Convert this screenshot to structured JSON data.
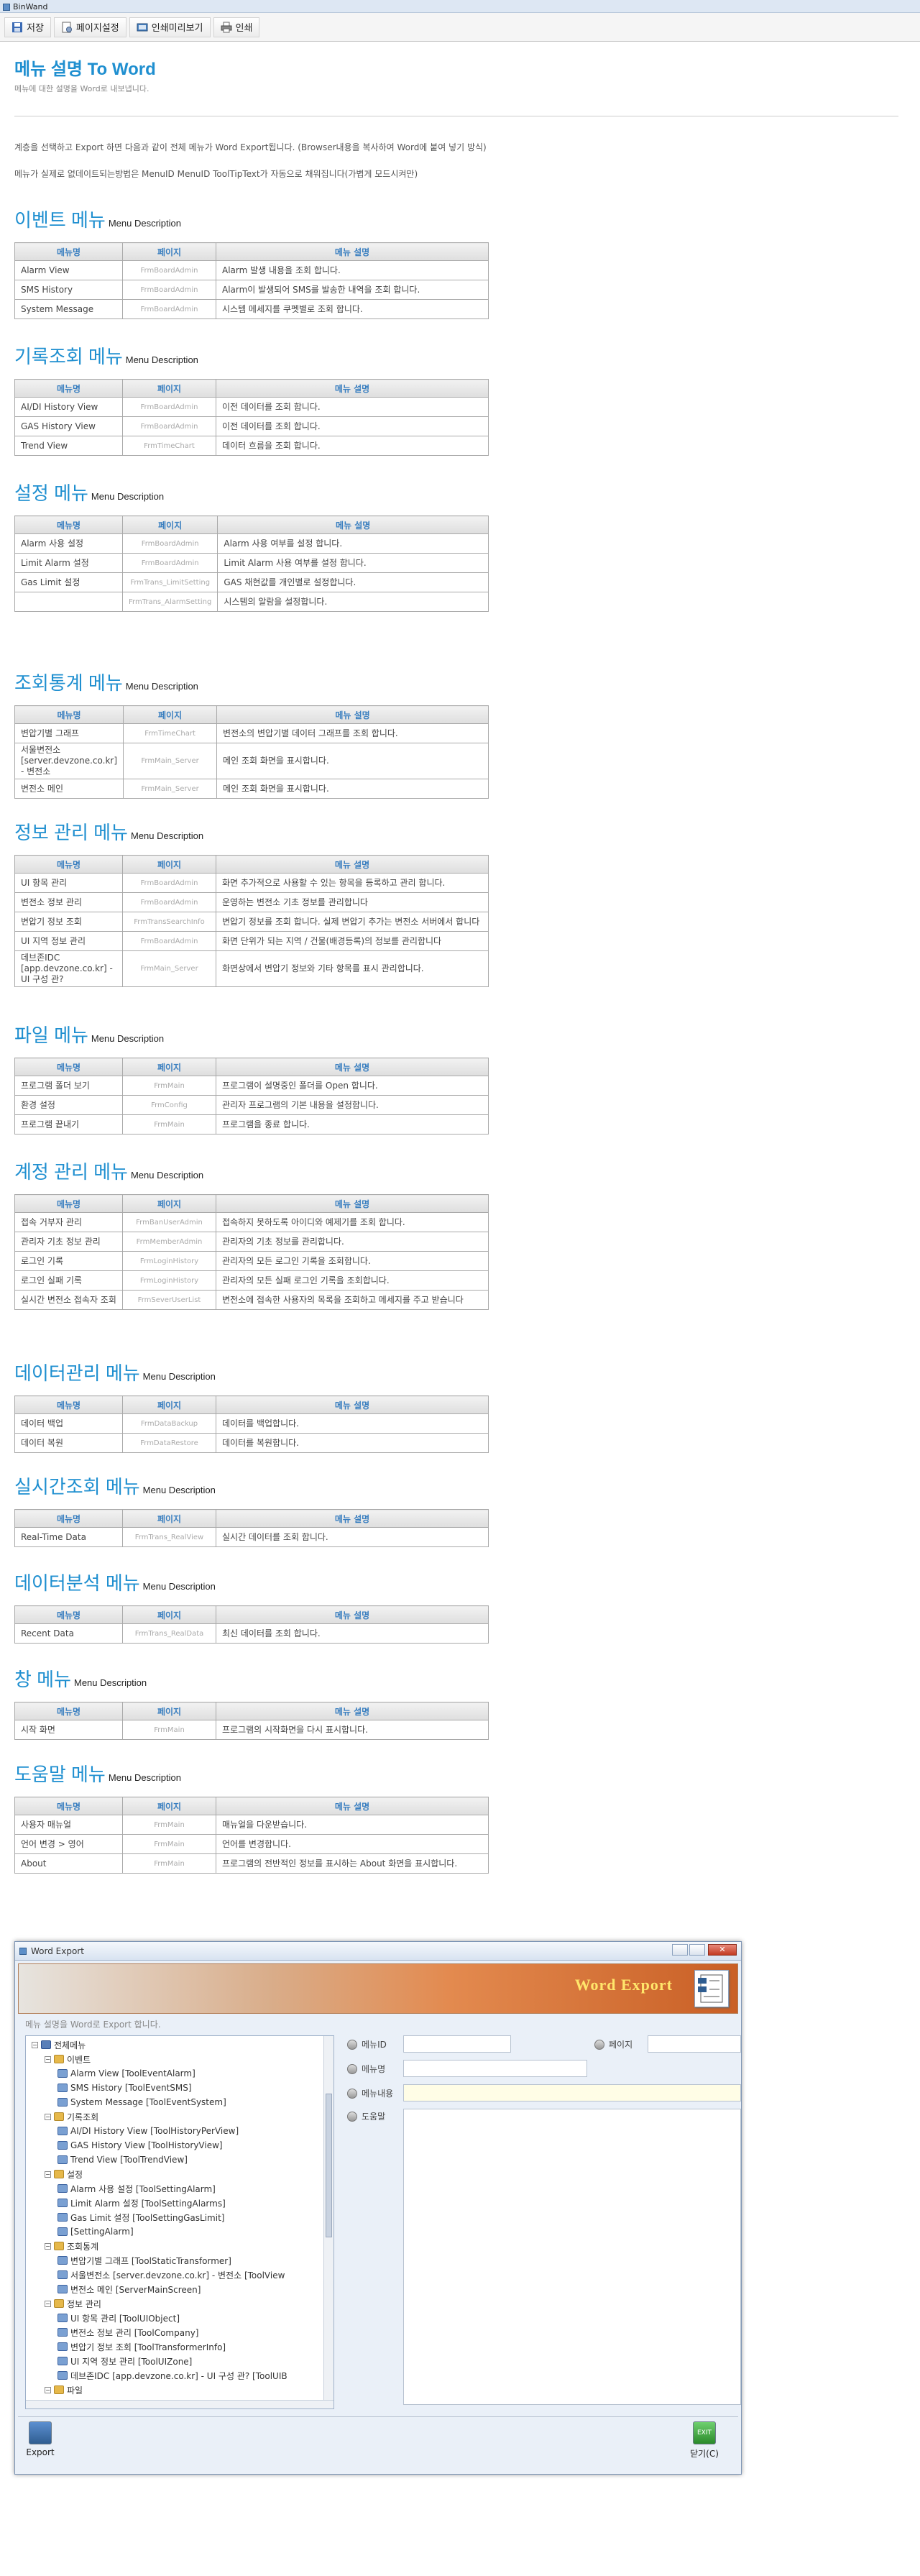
{
  "window_title": "BinWand",
  "toolbar": {
    "save": "저장",
    "page_setup": "페이지설정",
    "print_preview": "인쇄미리보기",
    "print": "인쇄"
  },
  "doc": {
    "title": "메뉴 설명 To Word",
    "subtitle": "메뉴에 대한 설명을 Word로 내보냅니다.",
    "note1": "계층을 선택하고 Export 하면 다음과 같이 전체 메뉴가 Word Export됩니다. (Browser내용을 복사하여 Word에 붙여 넣기 방식)",
    "note2": "메뉴가 실제로 없데이트되는방법은 MenuID MenuID ToolTipText가 자동으로 채워집니다(가볍게 모드시켜만)"
  },
  "table_headers": [
    "메뉴명",
    "페이지",
    "메뉴 설명"
  ],
  "desc_label": "Menu Description",
  "sections": [
    {
      "title": "이벤트 메뉴",
      "rows": [
        [
          "Alarm View",
          "FrmBoardAdmin",
          "Alarm 발생 내용을 조회 합니다."
        ],
        [
          "SMS History",
          "FrmBoardAdmin",
          "Alarm이 발생되어 SMS를 발송한 내역을 조회 합니다."
        ],
        [
          "System Message",
          "FrmBoardAdmin",
          "시스템 메세지를 쿠펫별로 조회 합니다."
        ]
      ]
    },
    {
      "title": "기록조회 메뉴",
      "rows": [
        [
          "AI/DI History View",
          "FrmBoardAdmin",
          "이전 데이터를 조회 합니다."
        ],
        [
          "GAS History View",
          "FrmBoardAdmin",
          "이전 데이터를 조회 합니다."
        ],
        [
          "Trend View",
          "FrmTimeChart",
          "데이터 흐름을 조회 합니다."
        ]
      ]
    },
    {
      "title": "설정 메뉴",
      "rows": [
        [
          "Alarm 사용 설정",
          "FrmBoardAdmin",
          "Alarm 사용 여부를 설정 합니다."
        ],
        [
          "Limit Alarm 설정",
          "FrmBoardAdmin",
          "Limit Alarm 사용 여부를 설정 합니다."
        ],
        [
          "Gas Limit 설정",
          "FrmTrans_LimitSetting",
          "GAS 채현값를 개인별로 설정합니다."
        ],
        [
          "",
          "FrmTrans_AlarmSetting",
          "시스템의 알람을 설정합니다."
        ]
      ]
    },
    {
      "title": "조회통계 메뉴",
      "rows": [
        [
          "변압기별 그래프",
          "FrmTimeChart",
          "변전소의 변압기별 데이터 그래프를 조회 합니다."
        ],
        [
          "서울변전소 [server.devzone.co.kr] - 변전소",
          "FrmMain_Server",
          "메인 조회 화면을 표시합니다."
        ],
        [
          "변전소 메인",
          "FrmMain_Server",
          "메인 조회 화면을 표시합니다."
        ]
      ]
    },
    {
      "title": "정보 관리 메뉴",
      "rows": [
        [
          "UI 항목 관리",
          "FrmBoardAdmin",
          "화면 추가적으로 사용할 수 있는 항목을 등록하고 관리 합니다."
        ],
        [
          "변전소 정보 관리",
          "FrmBoardAdmin",
          "운영하는 변전소 기초 정보를 관리합니다"
        ],
        [
          "변압기 정보 조회",
          "FrmTransSearchInfo",
          "변압기 정보를 조회 합니다. 실제 변압기 추가는 변전소 서버에서 합니다"
        ],
        [
          "UI 지역 정보 관리",
          "FrmBoardAdmin",
          "화면 단위가 되는 지역 / 건물(배경등록)의 정보를 관리합니다"
        ],
        [
          "데브존IDC [app.devzone.co.kr] - UI 구성 관?",
          "FrmMain_Server",
          "화면상에서 변압기 정보와 기타 항목를 표시 관리합니다."
        ]
      ]
    },
    {
      "title": "파일 메뉴",
      "rows": [
        [
          "프로그램 폴더 보기",
          "FrmMain",
          "프로그램이 설명중인 폴더를 Open 합니다."
        ],
        [
          "환경 설정",
          "FrmConfig",
          "관리자 프로그램의 기본 내용을 설정합니다."
        ],
        [
          "프로그램 끝내기",
          "FrmMain",
          "프로그램을 종료 합니다."
        ]
      ]
    },
    {
      "title": "계정 관리 메뉴",
      "rows": [
        [
          "접속 거부자 관리",
          "FrmBanUserAdmin",
          "접속하지 못하도록 아이디와 예제기를 조회 합니다."
        ],
        [
          "관리자 기초 정보 관리",
          "FrmMemberAdmin",
          "관리자의 기초 정보를 관리합니다."
        ],
        [
          "로그인 기록",
          "FrmLoginHistory",
          "관리자의 모든 로그인 기록을 조회합니다."
        ],
        [
          "로그인 실패 기록",
          "FrmLoginHistory",
          "관리자의 모든 실패 로그인 기록을 조회합니다."
        ],
        [
          "실시간 변전소 접속자 조회",
          "FrmSeverUserList",
          "변전소에 접속한 사용자의 목록을 조회하고 메세지를 주고 받습니다"
        ]
      ]
    },
    {
      "title": "데이터관리 메뉴",
      "rows": [
        [
          "데이터 백업",
          "FrmDataBackup",
          "데이터를 백업합니다."
        ],
        [
          "데이터 복원",
          "FrmDataRestore",
          "데이터를 복원합니다."
        ]
      ]
    },
    {
      "title": "실시간조회 메뉴",
      "rows": [
        [
          "Real-Time Data",
          "FrmTrans_RealView",
          "실시간 데이터를 조회 합니다."
        ]
      ]
    },
    {
      "title": "데이터분석 메뉴",
      "rows": [
        [
          "Recent Data",
          "FrmTrans_RealData",
          "최신 데이터를 조회 합니다."
        ]
      ]
    },
    {
      "title": "창 메뉴",
      "rows": [
        [
          "시작 화면",
          "FrmMain",
          "프로그램의 시작화면을 다시 표시합니다."
        ]
      ]
    },
    {
      "title": "도움말 메뉴",
      "rows": [
        [
          "사용자 매뉴얼",
          "FrmMain",
          "매뉴얼을 다운받습니다."
        ],
        [
          "언어 변경 > 영어",
          "FrmMain",
          "언어를 변경합니다."
        ],
        [
          "About",
          "FrmMain",
          "프로그램의 전반적인 정보를 표시하는 About 화면을 표시합니다."
        ]
      ]
    }
  ],
  "export_window": {
    "title": "Word Export",
    "banner_title": "Word Export",
    "subtitle": "메뉴 설명을 Word로 Export 합니다.",
    "tree": [
      {
        "level": 0,
        "label": "전체메뉴",
        "type": "root"
      },
      {
        "level": 1,
        "label": "이벤트",
        "type": "folder"
      },
      {
        "level": 2,
        "label": "Alarm View [ToolEventAlarm]",
        "type": "leaf"
      },
      {
        "level": 2,
        "label": "SMS History [ToolEventSMS]",
        "type": "leaf"
      },
      {
        "level": 2,
        "label": "System Message [ToolEventSystem]",
        "type": "leaf"
      },
      {
        "level": 1,
        "label": "기록조회",
        "type": "folder"
      },
      {
        "level": 2,
        "label": "AI/DI History View [ToolHistoryPerView]",
        "type": "leaf"
      },
      {
        "level": 2,
        "label": "GAS History View [ToolHistoryView]",
        "type": "leaf"
      },
      {
        "level": 2,
        "label": "Trend View [ToolTrendView]",
        "type": "leaf"
      },
      {
        "level": 1,
        "label": "설정",
        "type": "folder"
      },
      {
        "level": 2,
        "label": "Alarm 사용 설정 [ToolSettingAlarm]",
        "type": "leaf"
      },
      {
        "level": 2,
        "label": "Limit Alarm 설정 [ToolSettingAlarms]",
        "type": "leaf"
      },
      {
        "level": 2,
        "label": "Gas Limit 설정 [ToolSettingGasLimit]",
        "type": "leaf"
      },
      {
        "level": 2,
        "label": "[SettingAlarm]",
        "type": "leaf"
      },
      {
        "level": 1,
        "label": "조회통계",
        "type": "folder"
      },
      {
        "level": 2,
        "label": "변압기별 그래프 [ToolStaticTransformer]",
        "type": "leaf"
      },
      {
        "level": 2,
        "label": "서울변전소 [server.devzone.co.kr] - 변전소 [ToolView",
        "type": "leaf"
      },
      {
        "level": 2,
        "label": "변전소 메인 [ServerMainScreen]",
        "type": "leaf"
      },
      {
        "level": 1,
        "label": "정보 관리",
        "type": "folder"
      },
      {
        "level": 2,
        "label": "UI 항목 관리 [ToolUIObject]",
        "type": "leaf"
      },
      {
        "level": 2,
        "label": "변전소 정보 관리 [ToolCompany]",
        "type": "leaf"
      },
      {
        "level": 2,
        "label": "변압기 정보 조회 [ToolTransformerInfo]",
        "type": "leaf"
      },
      {
        "level": 2,
        "label": "UI 지역 정보 관리 [ToolUIZone]",
        "type": "leaf"
      },
      {
        "level": 2,
        "label": "데브존IDC [app.devzone.co.kr] - UI 구성 관? [ToolUIB",
        "type": "leaf"
      },
      {
        "level": 1,
        "label": "파일",
        "type": "folder"
      }
    ],
    "fields": {
      "menu_id": "메뉴ID",
      "page": "페이지",
      "menu_name": "메뉴명",
      "menu_content": "메뉴내용",
      "help": "도움말"
    },
    "export_button": "Export",
    "close_button": "닫기(C)",
    "exit_icon_text": "EXIT"
  }
}
